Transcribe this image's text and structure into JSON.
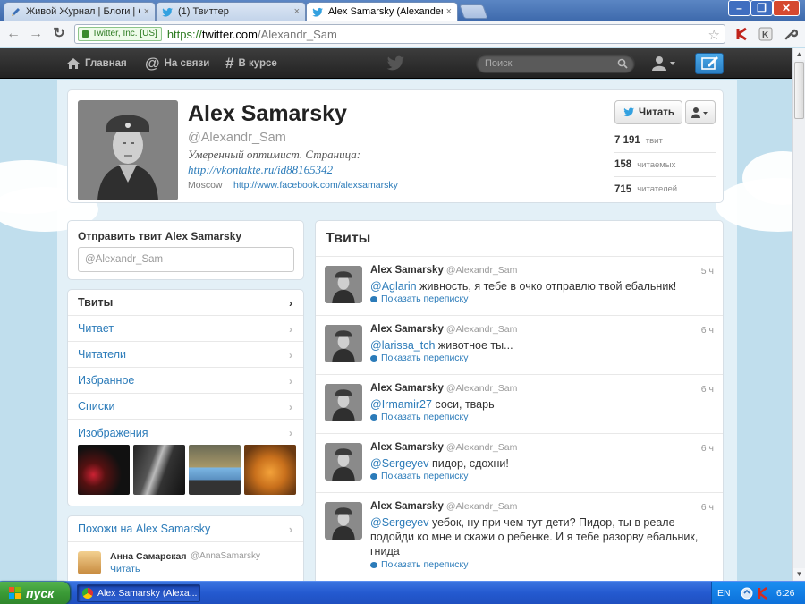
{
  "browser": {
    "tabs": [
      {
        "title": "Живой Журнал | Блоги | Соо",
        "close": "×"
      },
      {
        "title": "(1) Твиттер",
        "close": "×"
      },
      {
        "title": "Alex Samarsky (Alexander_Sam",
        "close": "×"
      }
    ],
    "window_buttons": {
      "minimize": "–",
      "maximize": "❐",
      "close": "✕"
    },
    "ev_label": "Twitter, Inc. [US]",
    "url_scheme": "https://",
    "url_host": "twitter.com",
    "url_path": "/Alexandr_Sam"
  },
  "topnav": {
    "home": "Главная",
    "connect": "На связи",
    "discover": "В курсе",
    "search_placeholder": "Поиск"
  },
  "profile": {
    "name": "Alex Samarsky",
    "handle": "@Alexandr_Sam",
    "bio_line1": "Умеренный оптимист. Страница:",
    "bio_link": "http://vkontakte.ru/id88165342",
    "location": "Moscow",
    "website": "http://www.facebook.com/alexsamarsky",
    "follow_button": "Читать",
    "stats": [
      {
        "value": "7 191",
        "label": "твит"
      },
      {
        "value": "158",
        "label": "читаемых"
      },
      {
        "value": "715",
        "label": "читателей"
      }
    ]
  },
  "tweet_to": {
    "heading": "Отправить твит Alex Samarsky",
    "placeholder": "@Alexandr_Sam"
  },
  "sidebar": {
    "items": [
      {
        "label": "Твиты"
      },
      {
        "label": "Читает"
      },
      {
        "label": "Читатели"
      },
      {
        "label": "Избранное"
      },
      {
        "label": "Списки"
      },
      {
        "label": "Изображения"
      }
    ]
  },
  "similar": {
    "heading": "Похожи на Alex Samarsky",
    "user_name": "Анна Самарская",
    "user_handle": "@AnnaSamarsky",
    "follow": "Читать"
  },
  "timeline": {
    "heading": "Твиты",
    "conversation_label": "Показать переписку",
    "tweets": [
      {
        "name": "Alex Samarsky",
        "handle": "@Alexandr_Sam",
        "time": "5 ч",
        "mention": "@Aglarin",
        "text": " живность, я тебе в очко отправлю твой ебальник!"
      },
      {
        "name": "Alex Samarsky",
        "handle": "@Alexandr_Sam",
        "time": "6 ч",
        "mention": "@larissa_tch",
        "text": " животное ты..."
      },
      {
        "name": "Alex Samarsky",
        "handle": "@Alexandr_Sam",
        "time": "6 ч",
        "mention": "@Irmamir27",
        "text": " соси, тварь"
      },
      {
        "name": "Alex Samarsky",
        "handle": "@Alexandr_Sam",
        "time": "6 ч",
        "mention": "@Sergeyev",
        "text": " пидор, сдохни!"
      },
      {
        "name": "Alex Samarsky",
        "handle": "@Alexandr_Sam",
        "time": "6 ч",
        "mention": "@Sergeyev",
        "text": " уебок, ну при чем тут дети? Пидор, ты в реале подойди ко мне и скажи о ребенке. И я тебе разорву ебальник, гнида"
      }
    ]
  },
  "taskbar": {
    "start": "пуск",
    "task_title": "Alex Samarsky (Alexa...",
    "lang": "EN",
    "clock": "6:26"
  },
  "colors": {
    "link": "#2b7bb9",
    "topbar": "#2b2b2b",
    "page_bg": "#c0deed",
    "compose": "#2a7fc4"
  },
  "icons": [
    "twitter-bird-icon",
    "home-icon",
    "at-icon",
    "hash-icon",
    "search-icon",
    "user-icon",
    "compose-icon",
    "star-icon",
    "wrench-icon",
    "chevron-right-icon",
    "conversation-icon"
  ]
}
